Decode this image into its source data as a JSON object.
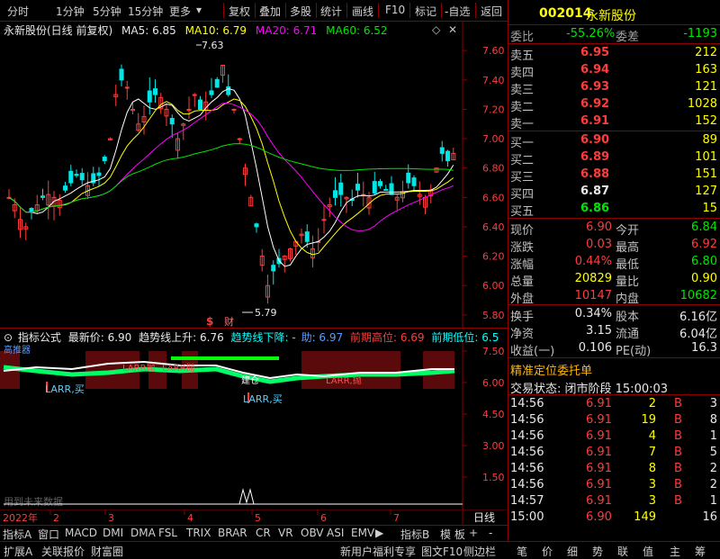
{
  "toolbar": {
    "tabs": [
      "分时",
      "1分钟",
      "5分钟",
      "15分钟",
      "更多",
      "复权",
      "叠加",
      "多股",
      "统计",
      "画线",
      "F10",
      "标记",
      "-自选",
      "返回"
    ]
  },
  "main_chart": {
    "stock_label": "永新股份(日线 前复权)",
    "ma5": "MA5: 6.85",
    "ma10": "MA10: 6.79",
    "ma20": "MA20: 6.71",
    "ma60": "MA60: 6.52",
    "y_ticks": [
      "7.60",
      "7.40",
      "7.20",
      "7.00",
      "6.80",
      "6.60",
      "6.40",
      "6.20",
      "6.00",
      "5.80"
    ],
    "high_label": "7.63",
    "low_label": "5.79",
    "marker_dollar": "$",
    "marker_cai": "财"
  },
  "indicator": {
    "name": "指标公式",
    "latest": "最新价: 6.90",
    "trend_up": "趋势线上升: 6.76",
    "trend_down": "趋势线下降: -",
    "buy": "助: 6.97",
    "prev_high": "前期高位: 6.69",
    "prev_low": "前期低位: 6.5",
    "y_ticks": [
      "7.50",
      "6.00",
      "4.50",
      "3.00",
      "1.50"
    ],
    "annot_larr_buy": "LARR,买",
    "annot_larr_buy2": "LARR,买",
    "annot_jian": "建仓",
    "annot_future": "用到未来数据",
    "annot_top": "高推器",
    "annot_pao": "LARR抛",
    "annot_pao2": "LARR抛",
    "annot_pao3": "LARR,抛"
  },
  "x_axis": {
    "labels": [
      "2022年",
      "2",
      "3",
      "4",
      "5",
      "6",
      "7"
    ],
    "right_label": "日线"
  },
  "indicator_tabs": [
    "指标A",
    "窗口",
    "MACD",
    "DMI",
    "DMA",
    "FSL",
    "TRIX",
    "BRAR",
    "CR",
    "VR",
    "OBV",
    "ASI",
    "EMV",
    "▶",
    "指标B",
    "模 板",
    "+",
    "-"
  ],
  "bottom_bar": {
    "left": [
      "扩展A",
      "关联报价",
      "财富圈"
    ],
    "promo": "新用户福利专享",
    "f10": "图文F10",
    "side": "侧边栏",
    "right_tabs": [
      "笔",
      "价",
      "细",
      "势",
      "联",
      "值",
      "主",
      "筹"
    ]
  },
  "quote": {
    "code": "002014",
    "name": "永新股份",
    "weibi_label": "委比",
    "weibi": "-55.26%",
    "weicha_label": "委差",
    "weicha": "-1193",
    "asks": [
      {
        "label": "卖五",
        "price": "6.95",
        "vol": "212"
      },
      {
        "label": "卖四",
        "price": "6.94",
        "vol": "163"
      },
      {
        "label": "卖三",
        "price": "6.93",
        "vol": "121"
      },
      {
        "label": "卖二",
        "price": "6.92",
        "vol": "1028"
      },
      {
        "label": "卖一",
        "price": "6.91",
        "vol": "152"
      }
    ],
    "bids": [
      {
        "label": "买一",
        "price": "6.90",
        "vol": "89"
      },
      {
        "label": "买二",
        "price": "6.89",
        "vol": "101"
      },
      {
        "label": "买三",
        "price": "6.88",
        "vol": "151"
      },
      {
        "label": "买四",
        "price": "6.87",
        "vol": "127"
      },
      {
        "label": "买五",
        "price": "6.86",
        "vol": "15"
      }
    ],
    "stats": [
      {
        "l1": "现价",
        "v1": "6.90",
        "l2": "今开",
        "v2": "6.84"
      },
      {
        "l1": "涨跌",
        "v1": "0.03",
        "l2": "最高",
        "v2": "6.92"
      },
      {
        "l1": "涨幅",
        "v1": "0.44%",
        "l2": "最低",
        "v2": "6.80"
      },
      {
        "l1": "总量",
        "v1": "20829",
        "l2": "量比",
        "v2": "0.90"
      },
      {
        "l1": "外盘",
        "v1": "10147",
        "l2": "内盘",
        "v2": "10682"
      }
    ],
    "stats2": [
      {
        "l1": "换手",
        "v1": "0.34%",
        "l2": "股本",
        "v2": "6.16亿"
      },
      {
        "l1": "净资",
        "v1": "3.15",
        "l2": "流通",
        "v2": "6.04亿"
      },
      {
        "l1": "收益(一)",
        "v1": "0.106",
        "l2": "PE(动)",
        "v2": "16.3"
      }
    ],
    "order_title": "精准定位委托单",
    "trade_state": "交易状态: 闭市阶段 15:00:03",
    "ticks": [
      {
        "time": "14:56",
        "price": "6.91",
        "vol": "2",
        "side": "B",
        "n": "3"
      },
      {
        "time": "14:56",
        "price": "6.91",
        "vol": "19",
        "side": "B",
        "n": "8"
      },
      {
        "time": "14:56",
        "price": "6.91",
        "vol": "4",
        "side": "B",
        "n": "1"
      },
      {
        "time": "14:56",
        "price": "6.91",
        "vol": "7",
        "side": "B",
        "n": "5"
      },
      {
        "time": "14:56",
        "price": "6.91",
        "vol": "8",
        "side": "B",
        "n": "2"
      },
      {
        "time": "14:56",
        "price": "6.91",
        "vol": "3",
        "side": "B",
        "n": "2"
      },
      {
        "time": "14:57",
        "price": "6.91",
        "vol": "3",
        "side": "B",
        "n": "1"
      },
      {
        "time": "15:00",
        "price": "6.90",
        "vol": "149",
        "side": "",
        "n": "16"
      }
    ]
  },
  "colors": {
    "up": "#ff3c3c",
    "down": "#00e600",
    "grid": "#8b0000",
    "ma5": "#ffffff",
    "ma10": "#ffff00",
    "ma20": "#ff00ff",
    "ma60": "#00e600"
  }
}
